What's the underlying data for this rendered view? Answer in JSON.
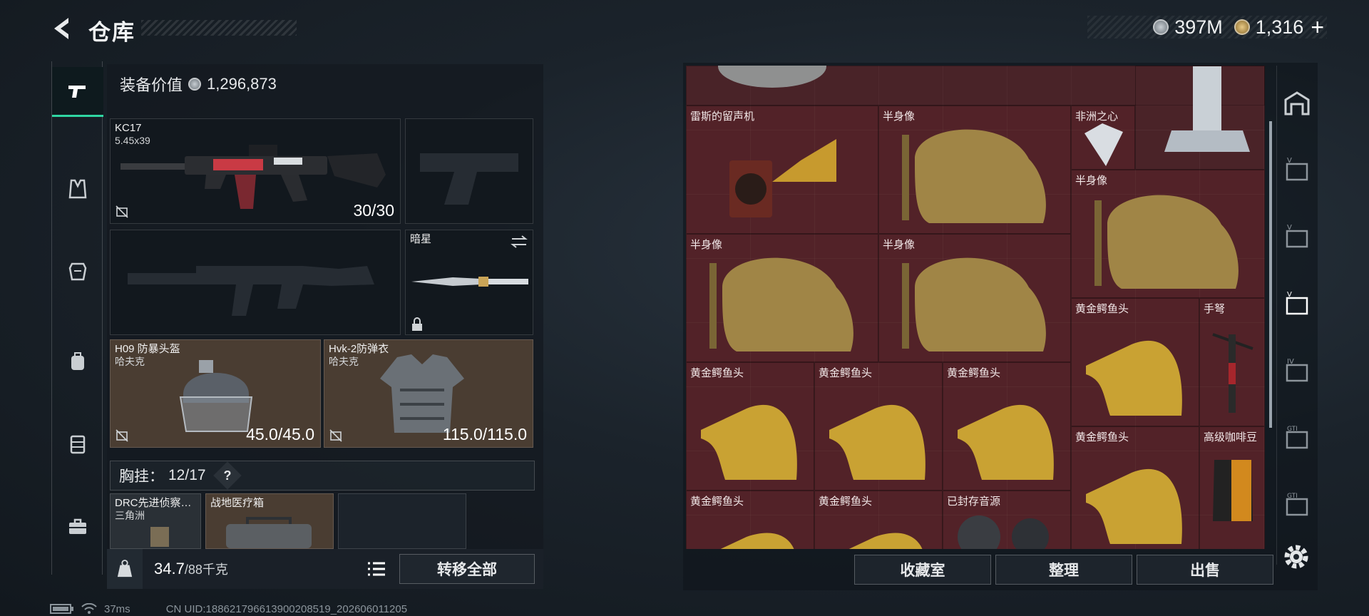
{
  "header": {
    "title": "仓库",
    "currencies": [
      {
        "icon": "silver-coin-icon",
        "value": "397M"
      },
      {
        "icon": "gold-coin-icon",
        "value": "1,316"
      }
    ],
    "add_symbol": "+"
  },
  "left_nav": {
    "items": [
      {
        "icon": "pistol-icon",
        "active": true
      },
      {
        "icon": "vest-icon"
      },
      {
        "icon": "armor-icon"
      },
      {
        "icon": "backpack-icon"
      },
      {
        "icon": "chest-rig-icon"
      },
      {
        "icon": "toolbox-icon"
      }
    ]
  },
  "equipment": {
    "value_label": "装备价值",
    "value": "1,296,873",
    "primary_weapon": {
      "name": "KC17",
      "caliber": "5.45x39",
      "ammo": "30/30"
    },
    "melee": {
      "name": "暗星"
    },
    "helmet": {
      "name": "H09 防暴头盔",
      "brand": "哈夫克",
      "durability": "45.0/45.0"
    },
    "armor": {
      "name": "Hvk-2防弹衣",
      "brand": "哈夫克",
      "durability": "115.0/115.0"
    },
    "vest_label": "胸挂：",
    "vest_capacity": "12/17",
    "vest_help": "?",
    "vest_items": [
      {
        "name": "DRC先进侦察…",
        "brand": "三角洲"
      },
      {
        "name": "战地医疗箱"
      }
    ]
  },
  "weight": {
    "current": "34.7",
    "capacity": "/88千克"
  },
  "buttons": {
    "transfer_all": "转移全部",
    "collection": "收藏室",
    "organize": "整理",
    "sell": "出售"
  },
  "storage": {
    "items": [
      {
        "name": "雷斯的留声机"
      },
      {
        "name": "半身像"
      },
      {
        "name": "非洲之心"
      },
      {
        "name": "半身像"
      },
      {
        "name": "半身像"
      },
      {
        "name": "半身像"
      },
      {
        "name": "黄金鳄鱼头"
      },
      {
        "name": "手弩"
      },
      {
        "name": "黄金鳄鱼头"
      },
      {
        "name": "黄金鳄鱼头"
      },
      {
        "name": "黄金鳄鱼头"
      },
      {
        "name": "黄金鳄鱼头"
      },
      {
        "name": "高级咖啡豆"
      },
      {
        "name": "黄金鳄鱼头"
      },
      {
        "name": "黄金鳄鱼头"
      },
      {
        "name": "已封存音源"
      }
    ]
  },
  "status": {
    "ping": "37ms",
    "uid": "CN UID:1886217966139002085​19_202606011205"
  }
}
